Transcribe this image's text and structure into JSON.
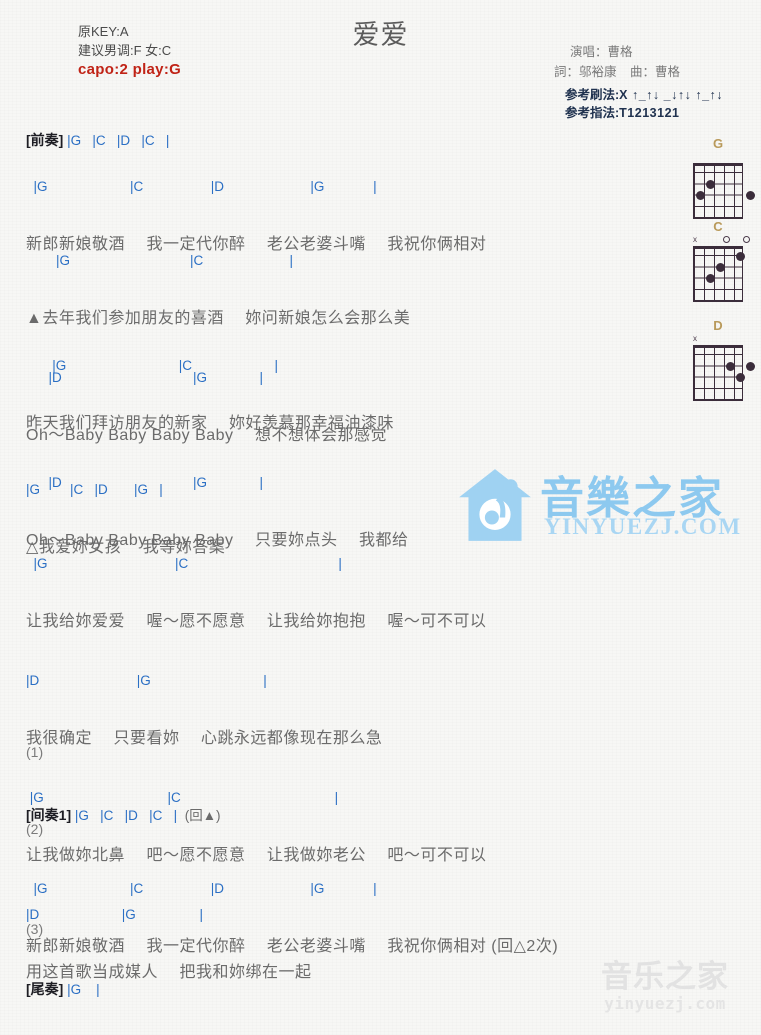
{
  "song": {
    "title": "爱爱",
    "original_key_label": "原KEY:A",
    "suggested_key_label": "建议男调:F 女:C",
    "capo_label": "capo:2 play:G"
  },
  "credits": {
    "singer": "演唱：曹格",
    "lyricist": "詞：邬裕康",
    "composer": "曲：曹格"
  },
  "patterns": {
    "strum_label": "参考刷法:",
    "strum_value": "X ↑_↑↓ _↓↑↓ ↑_↑↓",
    "pick_label": "参考指法:",
    "pick_value": "T1213121"
  },
  "sections": {
    "intro": {
      "tag": "[前奏]",
      "chords": "|G   |C   |D   |C   |"
    },
    "verse1": {
      "chords": "  |G                      |C                  |D                       |G             |",
      "lyrics": "新郎新娘敬酒　 我一定代你醉　 老公老婆斗嘴　 我祝你俩相对"
    },
    "verse2_line1": {
      "chords": "        |G                                |C                       |",
      "lyrics": "▲去年我们参加朋友的喜酒　 妳问新娘怎么会那么美"
    },
    "verse2_line2": {
      "chords": "      |D                                   |G              |",
      "lyrics": "Oh～Baby Baby Baby Baby　 想不想体会那感觉"
    },
    "verse3_line1": {
      "chords": "       |G                              |C                      |",
      "lyrics": "昨天我们拜访朋友的新家　 妳好羡慕那幸福油漆味"
    },
    "verse3_line2": {
      "chords": "      |D                                   |G              |",
      "lyrics": "Oh～Baby Baby Baby Baby　 只要妳点头　 我都给"
    },
    "chorus_line1": {
      "chords": "|G        |C   |D       |G   |",
      "lyrics": "△我爱妳女孩　 我等妳答案"
    },
    "chorus_line2": {
      "chords": "  |G                                  |C                                        |",
      "lyrics": "让我给妳爱爱　 喔～愿不愿意　 让我给妳抱抱　 喔～可不可以"
    },
    "chorus_line3": {
      "chords": "|D                          |G                              |",
      "lyrics": "我很确定　 只要看妳　 心跳永远都像现在那么急"
    },
    "chorus_line4": {
      "chords": " |G                                 |C                                         |",
      "lyrics": "让我做妳北鼻　 吧～愿不愿意　 让我做妳老公　 吧～可不可以"
    },
    "chorus_line5": {
      "chords": "|D                      |G                 |",
      "lyrics": "用这首歌当成媒人　 把我和妳绑在一起"
    },
    "mark1": "(1)",
    "interlude": {
      "tag": "[间奏1]",
      "chords": "|G   |C   |D   |C   |",
      "repeat": "(回▲)"
    },
    "mark2": "(2)",
    "verse4": {
      "chords": "  |G                      |C                  |D                       |G             |",
      "lyrics": "新郎新娘敬酒　 我一定代你醉　 老公老婆斗嘴　 我祝你俩相对",
      "repeat": " (回△2次)"
    },
    "mark3": "(3)",
    "outro": {
      "tag": "[尾奏]",
      "chords": "|G    |"
    }
  },
  "chord_diagrams": [
    {
      "name": "G",
      "open_markers": [],
      "dots": [
        {
          "string": 5,
          "fret": 2
        },
        {
          "string": 6,
          "fret": 3
        },
        {
          "string": 1,
          "fret": 3
        }
      ]
    },
    {
      "name": "C",
      "open_markers": [
        {
          "string": 6,
          "symbol": "x"
        },
        {
          "string": 3,
          "symbol": "o"
        },
        {
          "string": 1,
          "symbol": "o"
        }
      ],
      "dots": [
        {
          "string": 2,
          "fret": 1
        },
        {
          "string": 4,
          "fret": 2
        },
        {
          "string": 5,
          "fret": 3
        }
      ]
    },
    {
      "name": "D",
      "open_markers": [
        {
          "string": 6,
          "symbol": "x"
        }
      ],
      "dots": [
        {
          "string": 3,
          "fret": 2
        },
        {
          "string": 1,
          "fret": 2
        },
        {
          "string": 2,
          "fret": 3
        }
      ]
    }
  ],
  "watermarks": {
    "center_cn": "音樂之家",
    "center_url": "YINYUEZJ.COM",
    "bottom_cn": "音乐之家",
    "bottom_url": "yinyuezj.com"
  }
}
